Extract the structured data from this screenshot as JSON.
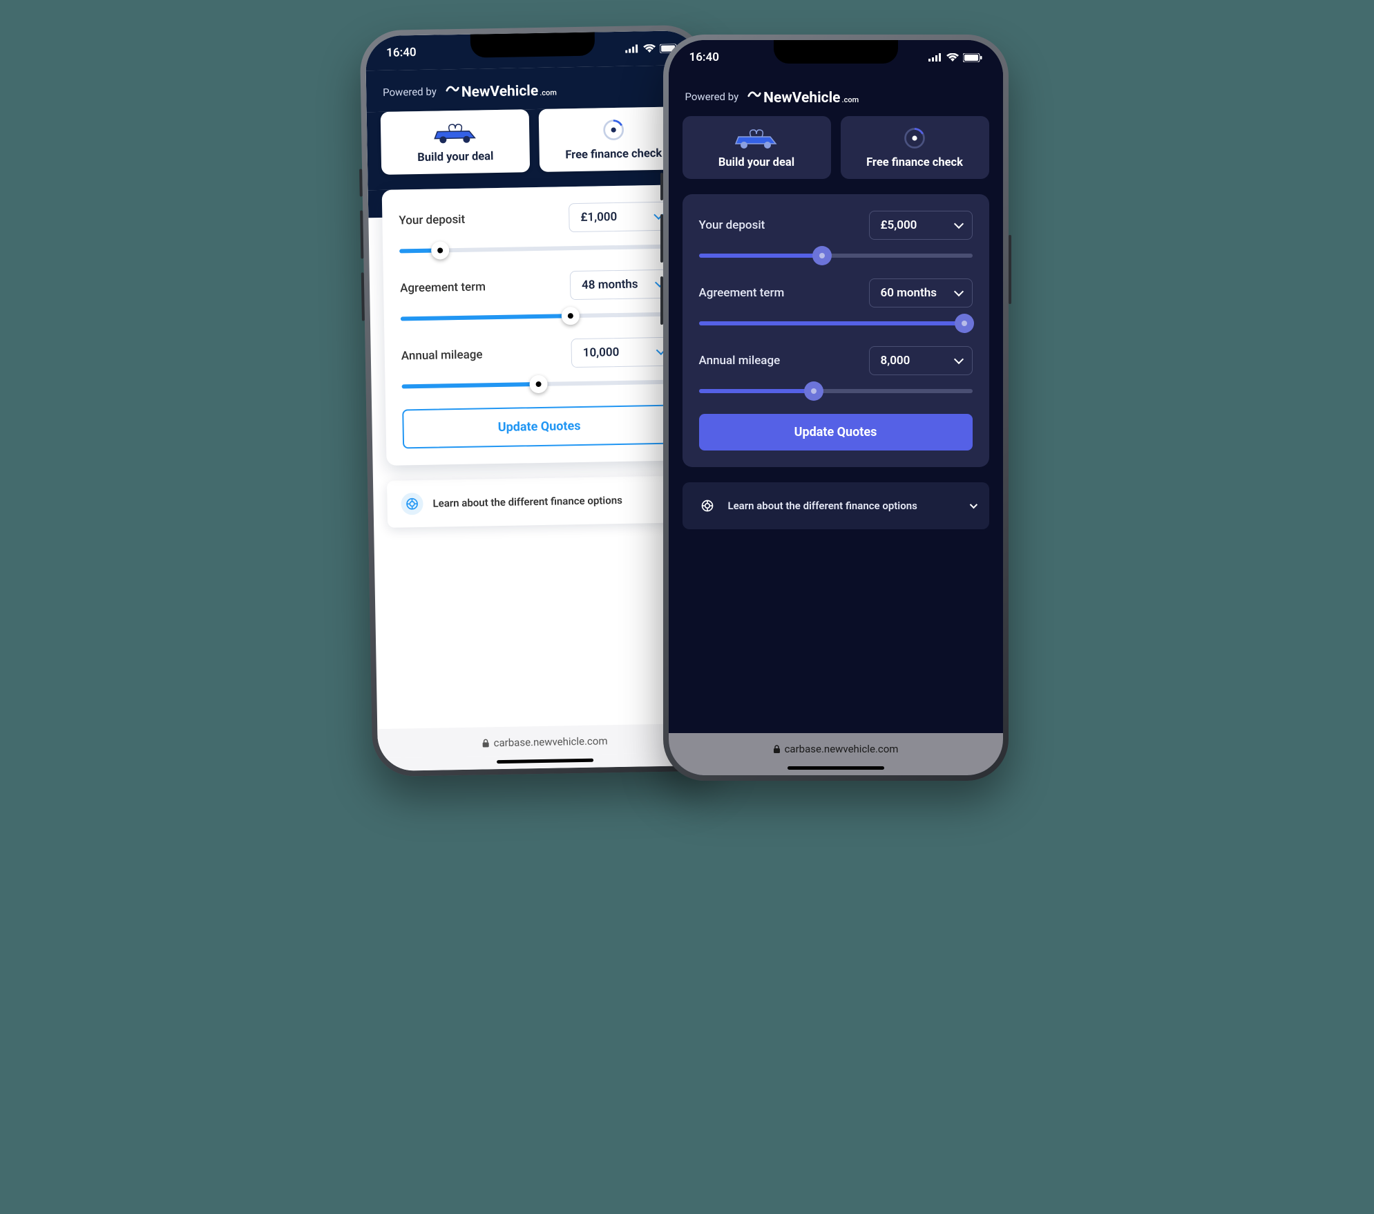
{
  "phones": {
    "light": {
      "status": {
        "time": "16:40"
      },
      "header": {
        "powered_by": "Powered by",
        "brand_name": "NewVehicle",
        "brand_tld": ".com"
      },
      "tabs": {
        "build": "Build your deal",
        "check": "Free finance check"
      },
      "deposit": {
        "label": "Your deposit",
        "value": "£1,000",
        "slider_pct": 15
      },
      "term": {
        "label": "Agreement term",
        "value": "48 months",
        "slider_pct": 62
      },
      "mileage": {
        "label": "Annual mileage",
        "value": "10,000",
        "slider_pct": 50
      },
      "button": "Update Quotes",
      "learn": "Learn about the different finance options",
      "url": "carbase.newvehicle.com"
    },
    "dark": {
      "status": {
        "time": "16:40"
      },
      "header": {
        "powered_by": "Powered by",
        "brand_name": "NewVehicle",
        "brand_tld": ".com"
      },
      "tabs": {
        "build": "Build your deal",
        "check": "Free finance check"
      },
      "deposit": {
        "label": "Your deposit",
        "value": "£5,000",
        "slider_pct": 45
      },
      "term": {
        "label": "Agreement term",
        "value": "60 months",
        "slider_pct": 97
      },
      "mileage": {
        "label": "Annual mileage",
        "value": "8,000",
        "slider_pct": 42
      },
      "button": "Update Quotes",
      "learn": "Learn about the different finance options",
      "url": "carbase.newvehicle.com"
    }
  }
}
